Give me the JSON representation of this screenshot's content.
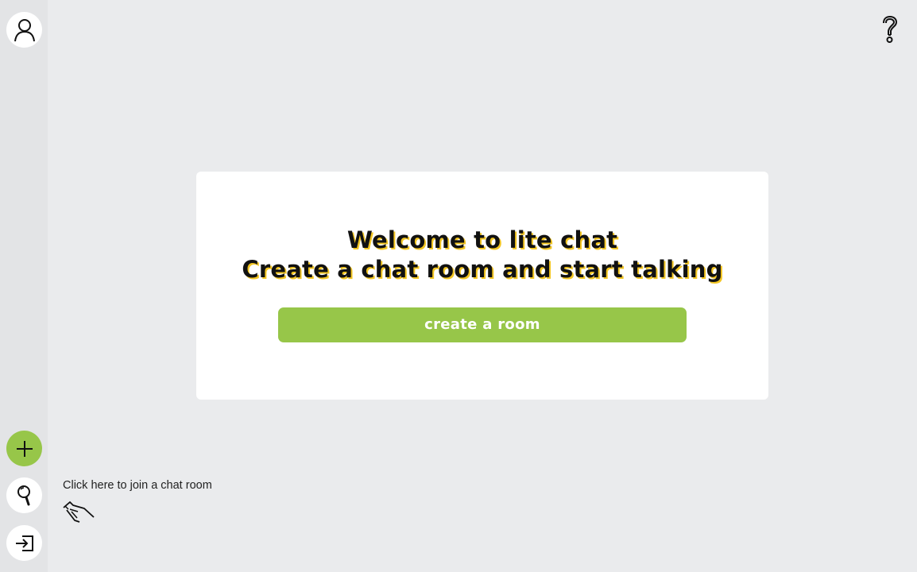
{
  "sidebar": {
    "profile": {
      "icon": "user-icon"
    },
    "add_room": {
      "icon": "plus-icon"
    },
    "search_room": {
      "icon": "search-icon"
    },
    "join_room": {
      "icon": "login-icon"
    }
  },
  "header": {
    "help": {
      "icon": "help-icon"
    }
  },
  "welcome_card": {
    "title_line_1": "Welcome to lite chat",
    "title_line_2": "Create a chat room and start talking",
    "create_button_label": "create a room"
  },
  "join_hint": {
    "text": "Click here to join a chat room",
    "icon": "pointing-hand-icon"
  },
  "colors": {
    "accent_green": "#97c649",
    "title_shadow_yellow": "#f3c623",
    "background": "#eaebed",
    "sidebar_background": "#e3e4e6",
    "card_background": "#ffffff"
  }
}
